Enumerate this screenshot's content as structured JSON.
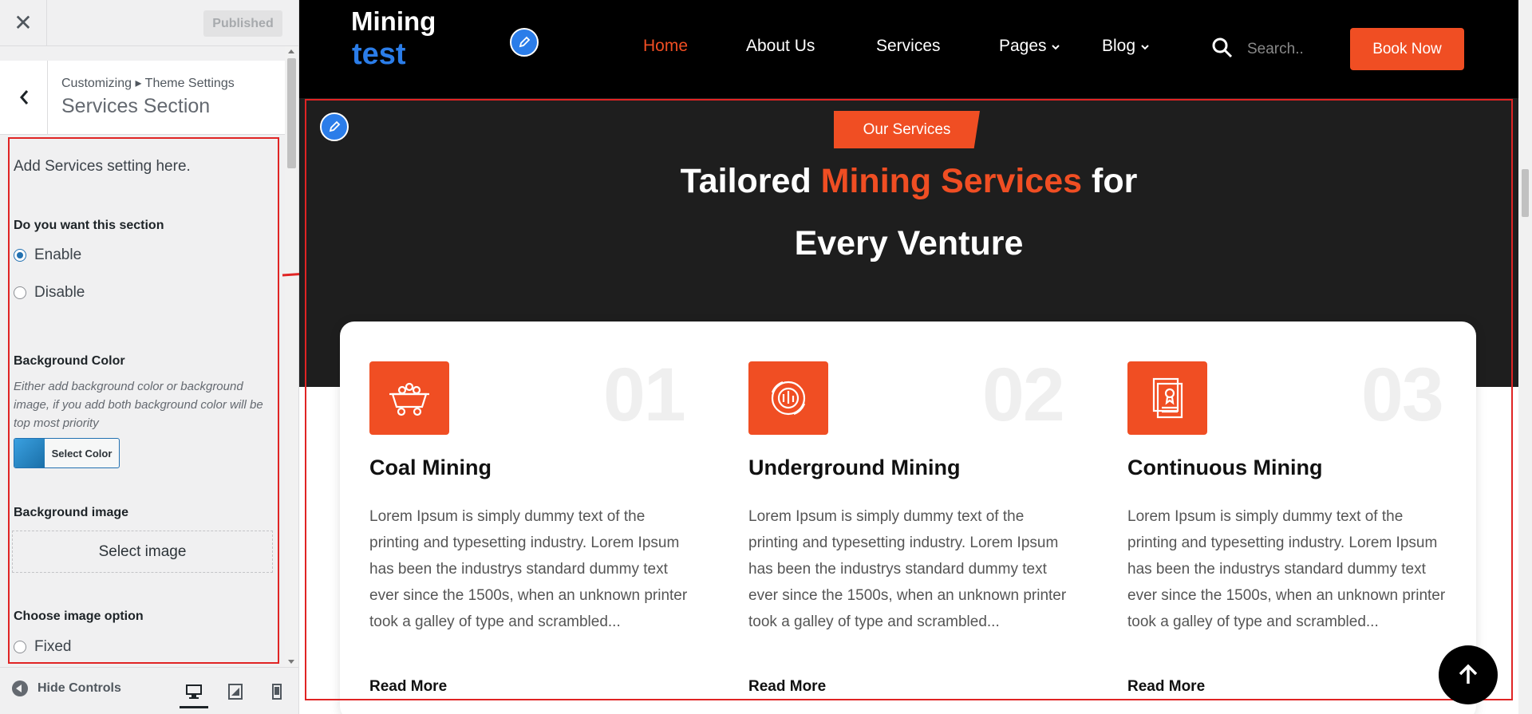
{
  "customizer": {
    "publish_label": "Published",
    "breadcrumb": "Customizing ▸ Theme Settings",
    "section_title": "Services Section",
    "description": "Add Services setting here.",
    "section_toggle": {
      "label": "Do you want this section",
      "options": [
        "Enable",
        "Disable"
      ],
      "selected": "Enable"
    },
    "background_color": {
      "label": "Background Color",
      "help": "Either add background color or background image, if you add both background color will be top most priority",
      "button_label": "Select Color",
      "swatch_color": "#1a6fa8"
    },
    "background_image": {
      "label": "Background image",
      "button_label": "Select image"
    },
    "image_option": {
      "label": "Choose image option",
      "options": [
        "Fixed"
      ]
    },
    "footer": {
      "hide_controls_label": "Hide Controls",
      "devices": [
        "desktop",
        "tablet",
        "mobile"
      ],
      "active_device": "desktop"
    }
  },
  "site": {
    "logo_line1": "Mining",
    "logo_line2": "test",
    "nav": {
      "items": [
        "Home",
        "About Us",
        "Services",
        "Pages",
        "Blog"
      ],
      "active": "Home",
      "search_placeholder": "Search..",
      "cta_label": "Book Now"
    },
    "services": {
      "eyebrow": "Our Services",
      "heading_pre": "Tailored ",
      "heading_highlight": "Mining Services",
      "heading_post": " for",
      "heading_line2": "Every Venture",
      "cards": [
        {
          "number": "01",
          "icon": "mine-cart-icon",
          "title": "Coal Mining",
          "text": "Lorem Ipsum is simply dummy text of the printing and typesetting industry. Lorem Ipsum has been the industrys standard dummy text ever since the 1500s, when an unknown printer took a galley of type and scrambled...",
          "link": "Read More"
        },
        {
          "number": "02",
          "icon": "gear-cycle-icon",
          "title": "Underground Mining",
          "text": "Lorem Ipsum is simply dummy text of the printing and typesetting industry. Lorem Ipsum has been the industrys standard dummy text ever since the 1500s, when an unknown printer took a galley of type and scrambled...",
          "link": "Read More"
        },
        {
          "number": "03",
          "icon": "certificate-document-icon",
          "title": "Continuous Mining",
          "text": "Lorem Ipsum is simply dummy text of the printing and typesetting industry. Lorem Ipsum has been the industrys standard dummy text ever since the 1500s, when an unknown printer took a galley of type and scrambled...",
          "link": "Read More"
        }
      ]
    }
  },
  "colors": {
    "accent": "#f04e23",
    "brand_blue": "#2b7de9",
    "highlight_border": "#e02424",
    "nav_bg": "#000000",
    "band_bg": "#1e1e1e"
  }
}
